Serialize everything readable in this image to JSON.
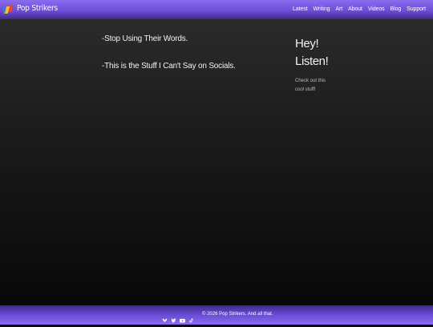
{
  "header": {
    "brand": "Pop Strikers",
    "nav": [
      "Latest",
      "Writing",
      "Art",
      "About",
      "Videos",
      "Blog",
      "Support"
    ]
  },
  "main": {
    "posts": [
      "-Stop Using Their Words.",
      "-This is the Stuff I Can't Say on Socials."
    ]
  },
  "sidebar": {
    "title": "Hey! Listen!",
    "text": "Check out this cool stuff!"
  },
  "footer": {
    "social_icons": [
      "bluesky-icon",
      "twitter-icon",
      "youtube-icon",
      "tiktok-icon"
    ],
    "copyright": "© 2026 Pop Strikers. And all that."
  },
  "colors": {
    "header_purple": "#6d4fd8",
    "background": "#1b1b1b",
    "logo_blue": "#3a7bd5",
    "logo_yellow": "#f2c12e",
    "logo_red": "#e0463a"
  }
}
